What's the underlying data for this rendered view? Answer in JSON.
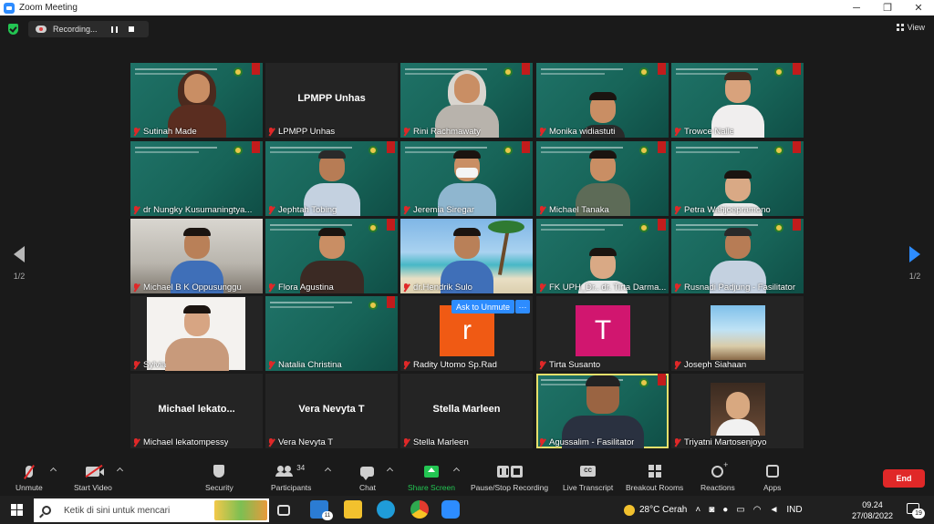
{
  "window": {
    "title": "Zoom Meeting"
  },
  "top_bar": {
    "recording_status": "Recording...",
    "view_label": "View"
  },
  "pagination": {
    "left_page": "1/2",
    "right_page": "1/2"
  },
  "participants": [
    {
      "name": "Sutinah Made",
      "bg": "slide",
      "person": "hijab-dark"
    },
    {
      "name": "LPMPP Unhas",
      "bg": "dark",
      "center_label": "LPMPP Unhas"
    },
    {
      "name": "Rini Rachmawaty",
      "bg": "slide",
      "person": "hijab-light"
    },
    {
      "name": "Monika widiastuti",
      "bg": "slide",
      "person": "woman-low"
    },
    {
      "name": "Trowce  Nalle",
      "bg": "slide",
      "person": "woman"
    },
    {
      "name": "dr Nungky Kusumaningtya...",
      "bg": "slide",
      "person": "none"
    },
    {
      "name": "Jephtah Tobing",
      "bg": "slide",
      "person": "man-glasses"
    },
    {
      "name": "Jeremia Siregar",
      "bg": "slide",
      "person": "man-mask"
    },
    {
      "name": "Michael Tanaka",
      "bg": "slide",
      "person": "man"
    },
    {
      "name": "Petra Wahjoepramono",
      "bg": "slide",
      "person": "man-low"
    },
    {
      "name": "Michael B K Oppusunggu",
      "bg": "room",
      "person": "man-blue"
    },
    {
      "name": "Flora Agustina",
      "bg": "slide",
      "person": "woman-dark"
    },
    {
      "name": "dr.Hendrik Sulo",
      "bg": "beach",
      "person": "man-blue"
    },
    {
      "name": "FK UPH_Dr.. dr. Tirta Darma...",
      "bg": "slide",
      "person": "man-low"
    },
    {
      "name": "Rusnadi Padjung - Fasilitator",
      "bg": "slide",
      "person": "man-glasses"
    },
    {
      "name": "Sylvia",
      "bg": "white-photo",
      "person": "hand"
    },
    {
      "name": "Natalia Christina",
      "bg": "slide",
      "person": "none"
    },
    {
      "name": "Radity Utomo Sp.Rad",
      "bg": "dark",
      "avatar_letter": "r",
      "avatar_color": "#f05a14"
    },
    {
      "name": "Tirta Susanto",
      "bg": "dark",
      "avatar_letter": "T",
      "avatar_color": "#d1166f"
    },
    {
      "name": "Joseph Siahaan",
      "bg": "dark",
      "photo": "beach-chairs"
    },
    {
      "name": "Michael lekatompessy",
      "bg": "dark",
      "center_label": "Michael  lekato..."
    },
    {
      "name": "Vera Nevyta T",
      "bg": "dark",
      "center_label": "Vera Nevyta T"
    },
    {
      "name": "Stella Marleen",
      "bg": "dark",
      "center_label": "Stella Marleen"
    },
    {
      "name": "Agussalim - Fasilitator",
      "bg": "slide",
      "person": "man-big",
      "active": true
    },
    {
      "name": "Triyatni Martosenjoyo",
      "bg": "dark",
      "photo": "woman-portrait"
    }
  ],
  "tile_overlay": {
    "ask_to_unmute": "Ask to Unmute",
    "more": "···"
  },
  "toolbar": {
    "unmute": "Unmute",
    "start_video": "Start Video",
    "security": "Security",
    "participants": "Participants",
    "participant_count": "34",
    "chat": "Chat",
    "share_screen": "Share Screen",
    "pause_stop_recording": "Pause/Stop Recording",
    "live_transcript": "Live Transcript",
    "cc_text": "CC",
    "breakout_rooms": "Breakout Rooms",
    "reactions": "Reactions",
    "apps": "Apps",
    "end": "End"
  },
  "taskbar": {
    "search_placeholder": "Ketik di sini untuk mencari",
    "mail_badge": "11",
    "weather": "28°C  Cerah",
    "language": "IND",
    "time": "09.24",
    "date": "27/08/2022",
    "notification_count": "19"
  },
  "colors": {
    "accent": "#2d8cff",
    "end_red": "#e02828",
    "share_green": "#23c552",
    "active_speaker": "#e6e06b"
  }
}
